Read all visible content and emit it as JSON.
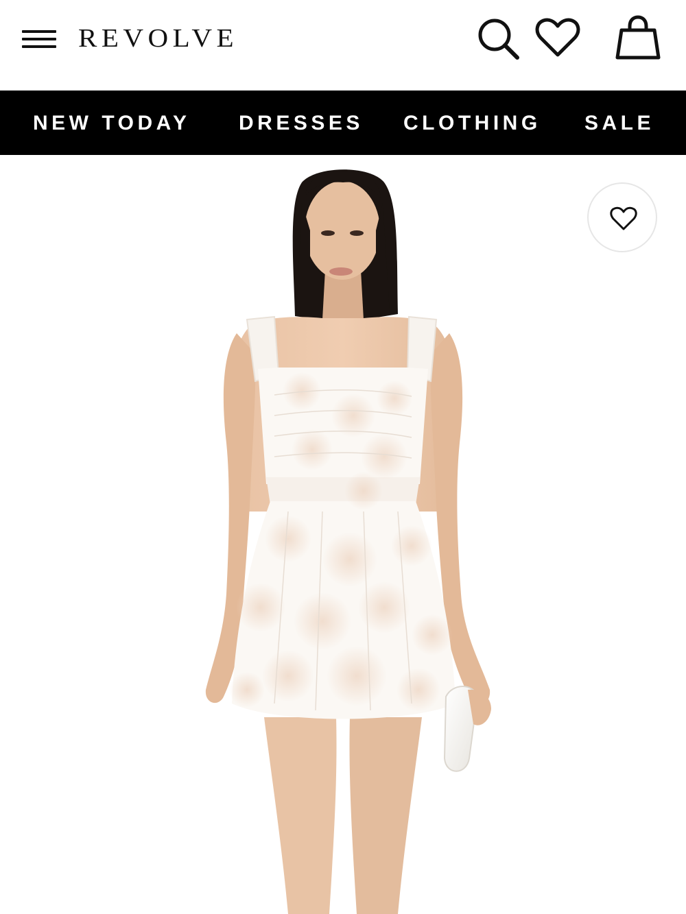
{
  "header": {
    "brand": "REVOLVE",
    "icons": [
      "menu-icon",
      "search-icon",
      "heart-icon",
      "shopping-bag-icon"
    ]
  },
  "nav": {
    "items": [
      {
        "label": "NEW TODAY"
      },
      {
        "label": "DRESSES"
      },
      {
        "label": "CLOTHING"
      },
      {
        "label": "SALE"
      }
    ],
    "background": "#000000",
    "text_color": "#ffffff"
  },
  "product": {
    "image_alt": "Model wearing a white floral square-neck mini dress holding a white clutch",
    "wishlist_icon": "heart-icon"
  }
}
